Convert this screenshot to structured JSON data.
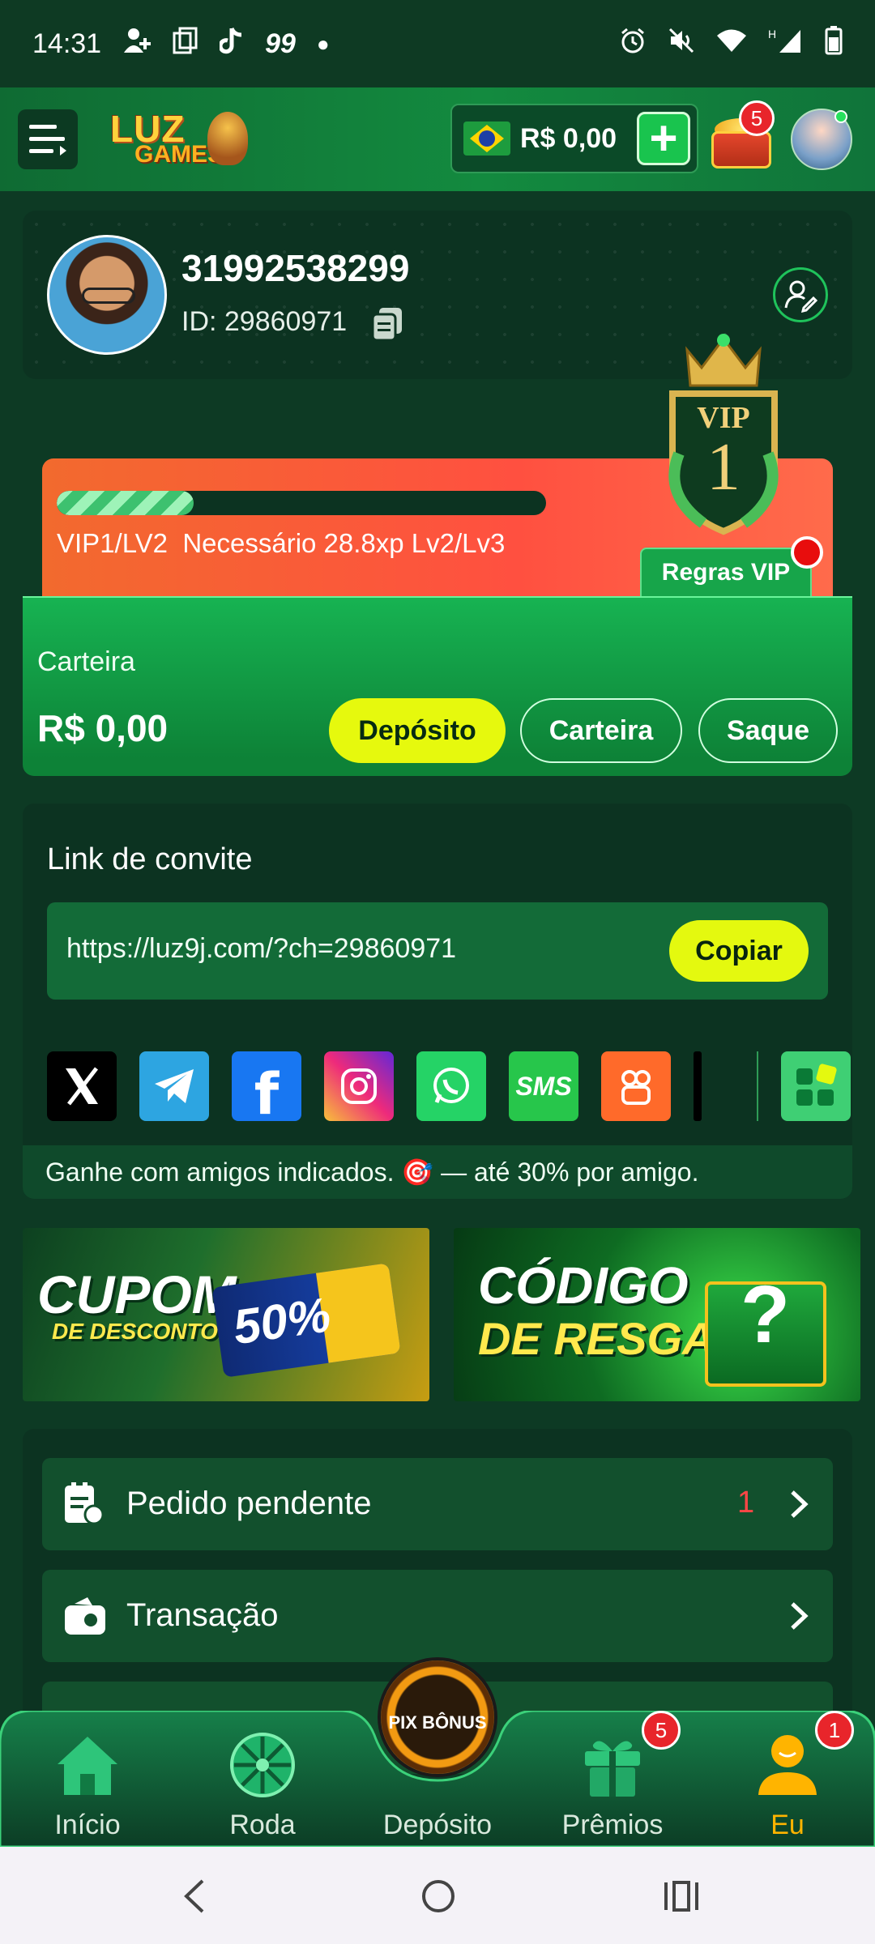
{
  "status_bar": {
    "time": "14:31",
    "notification_text": "99"
  },
  "header": {
    "logo_text_top": "LUZ",
    "logo_text_bottom": "GAMES",
    "balance": "R$ 0,00",
    "chest_badge": "5"
  },
  "profile": {
    "phone": "31992538299",
    "id_label": "ID: 29860971"
  },
  "vip": {
    "progress_fraction": 0.28,
    "level_text": "VIP1/LV2",
    "required_text": "Necessário 28.8xp Lv2/Lv3",
    "emblem_title": "VIP",
    "emblem_level": "1",
    "rules_label": "Regras VIP"
  },
  "wallet": {
    "label": "Carteira",
    "amount": "R$ 0,00",
    "deposit_label": "Depósito",
    "wallet_label": "Carteira",
    "withdraw_label": "Saque"
  },
  "invite": {
    "title": "Link de convite",
    "link": "https://luz9j.com/?ch=29860971",
    "copy_label": "Copiar",
    "sms_label": "SMS",
    "footer": "Ganhe com amigos indicados. 🎯 — até 30% por amigo."
  },
  "banners": {
    "cupom_line1": "CUPOM",
    "cupom_line2": "DE DESCONTO",
    "cupom_pct": "50%",
    "codigo_line1": "CÓDIGO",
    "codigo_line2": "DE RESGATE"
  },
  "menu": {
    "items": [
      {
        "label": "Pedido pendente",
        "count": "1"
      },
      {
        "label": "Transação",
        "count": ""
      }
    ]
  },
  "bottom_nav": {
    "items": [
      {
        "label": "Início"
      },
      {
        "label": "Roda"
      },
      {
        "label": "Depósito"
      },
      {
        "label": "Prêmios",
        "badge": "5"
      },
      {
        "label": "Eu",
        "badge": "1"
      }
    ],
    "center_text": "PIX BÔNUS",
    "active_color": "#ffb400"
  }
}
